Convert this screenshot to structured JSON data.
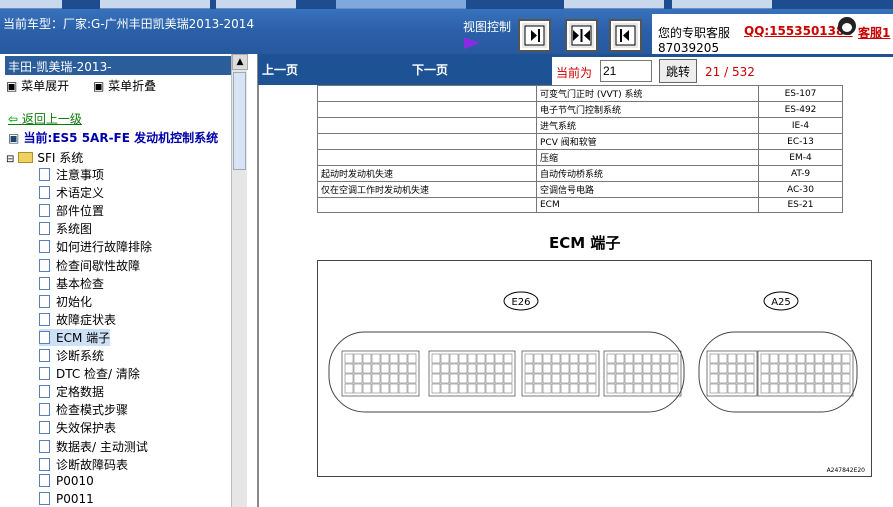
{
  "header": {
    "car_label": "当前车型：厂家:G-广州丰田凯美瑞2013-2014",
    "view_control": "视图控制"
  },
  "service": {
    "text": "您的专职客服",
    "qq": "QQ:1553501388",
    "number": "87039205",
    "kefu": "客服1"
  },
  "sidebar": {
    "title": "丰田-凯美瑞-2013-",
    "expand": "菜单展开",
    "collapse": "菜单折叠",
    "back": "返回上一级",
    "current": "当前:ES5 5AR-FE 发动机控制系统",
    "root": "SFI 系统",
    "items": [
      "注意事项",
      "术语定义",
      "部件位置",
      "系统图",
      "如何进行故障排除",
      "检查间歇性故障",
      "基本检查",
      "初始化",
      "故障症状表",
      "ECM 端子",
      "诊断系统",
      "DTC 检查/ 清除",
      "定格数据",
      "检查模式步骤",
      "失效保护表",
      "数据表/ 主动测试",
      "诊断故障码表",
      "P0010",
      "P0011"
    ]
  },
  "pager": {
    "prev": "上一页",
    "next": "下一页",
    "label": "当前为",
    "value": "21",
    "go": "跳转",
    "total": "21 / 532"
  },
  "doc": {
    "rows": [
      [
        "",
        "可变气门正时 (VVT) 系统",
        "ES-107"
      ],
      [
        "",
        "电子节气门控制系统",
        "ES-492"
      ],
      [
        "",
        "进气系统",
        "IE-4"
      ],
      [
        "",
        "PCV 阀和软管",
        "EC-13"
      ],
      [
        "",
        "压缩",
        "EM-4"
      ],
      [
        "起动时发动机失速",
        "自动传动桥系统",
        "AT-9"
      ],
      [
        "仅在空调工作时发动机失速",
        "空调信号电路",
        "AC-30"
      ],
      [
        "",
        "ECM",
        "ES-21"
      ]
    ],
    "ecm_title": "ECM 端子",
    "conn1": "E26",
    "conn2": "A25",
    "fig_id": "A247842E20"
  }
}
